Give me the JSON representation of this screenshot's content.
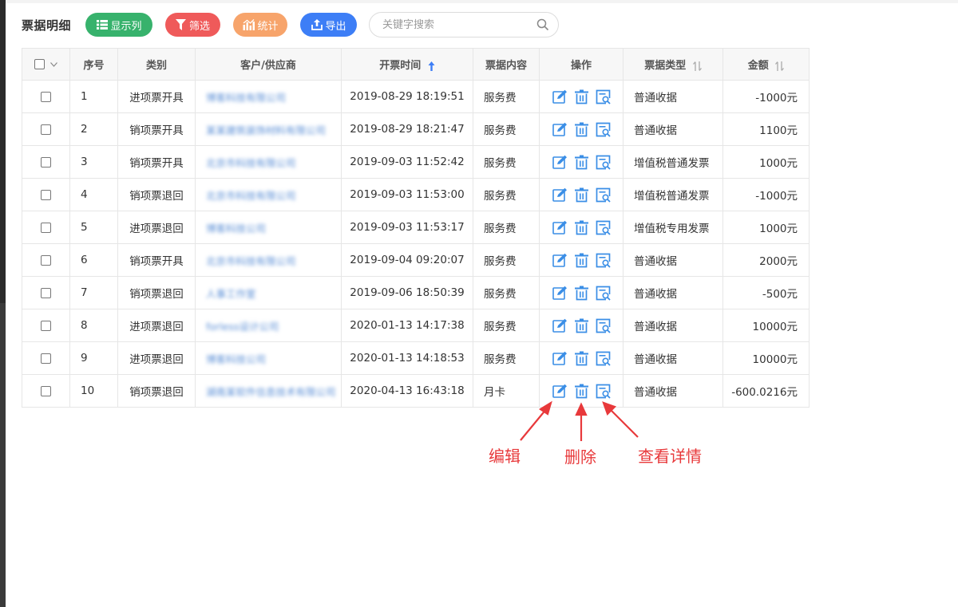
{
  "toolbar": {
    "title": "票据明细",
    "buttons": {
      "columns": "显示列",
      "filter": "筛选",
      "stats": "统计",
      "export": "导出"
    },
    "search_placeholder": "关键字搜索"
  },
  "table": {
    "headers": {
      "index": "序号",
      "category": "类别",
      "customer": "客户/供应商",
      "time": "开票时间",
      "content": "票据内容",
      "ops": "操作",
      "type": "票据类型",
      "amount": "金额"
    },
    "rows": [
      {
        "index": "1",
        "category": "进项票开具",
        "customer": "博客科技有限公司",
        "time": "2019-08-29 18:19:51",
        "content": "服务费",
        "type": "普通收据",
        "amount": "-1000元"
      },
      {
        "index": "2",
        "category": "销项票开具",
        "customer": "某某建筑装饰材料有限公司",
        "time": "2019-08-29 18:21:47",
        "content": "服务费",
        "type": "普通收据",
        "amount": "1100元"
      },
      {
        "index": "3",
        "category": "销项票开具",
        "customer": "北京市科技有限公司",
        "time": "2019-09-03 11:52:42",
        "content": "服务费",
        "type": "增值税普通发票",
        "amount": "1000元"
      },
      {
        "index": "4",
        "category": "销项票退回",
        "customer": "北京市科技有限公司",
        "time": "2019-09-03 11:53:00",
        "content": "服务费",
        "type": "增值税普通发票",
        "amount": "-1000元"
      },
      {
        "index": "5",
        "category": "进项票退回",
        "customer": "博客科技公司",
        "time": "2019-09-03 11:53:17",
        "content": "服务费",
        "type": "增值税专用发票",
        "amount": "1000元"
      },
      {
        "index": "6",
        "category": "销项票开具",
        "customer": "北京市科技有限公司",
        "time": "2019-09-04 09:20:07",
        "content": "服务费",
        "type": "普通收据",
        "amount": "2000元"
      },
      {
        "index": "7",
        "category": "销项票退回",
        "customer": "人事工作室",
        "time": "2019-09-06 18:50:39",
        "content": "服务费",
        "type": "普通收据",
        "amount": "-500元"
      },
      {
        "index": "8",
        "category": "进项票退回",
        "customer": "forless设计公司",
        "time": "2020-01-13 14:17:38",
        "content": "服务费",
        "type": "普通收据",
        "amount": "10000元"
      },
      {
        "index": "9",
        "category": "进项票退回",
        "customer": "博客科技公司",
        "time": "2020-01-13 14:18:53",
        "content": "服务费",
        "type": "普通收据",
        "amount": "10000元"
      },
      {
        "index": "10",
        "category": "销项票退回",
        "customer": "湖南某软件信息技术有限公司",
        "time": "2020-04-13 16:43:18",
        "content": "月卡",
        "type": "普通收据",
        "amount": "-600.0216元"
      }
    ]
  },
  "annotations": {
    "edit": "编辑",
    "delete": "删除",
    "view": "查看详情"
  },
  "colors": {
    "accent_blue": "#3d7ef6",
    "green": "#37b26c",
    "red": "#ef5a5a",
    "orange": "#f7a46b",
    "op_icon": "#3a8ee6",
    "annotation_red": "#e8393b"
  }
}
